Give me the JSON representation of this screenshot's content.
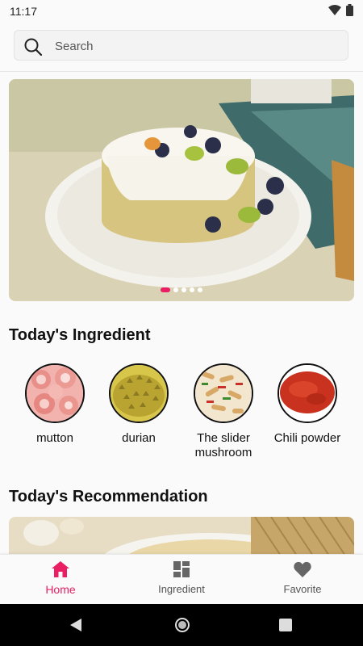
{
  "status": {
    "time": "11:17"
  },
  "search": {
    "placeholder": "Search"
  },
  "banner": {
    "dot_count": 5,
    "active_index": 0
  },
  "sections": {
    "ingredient_title": "Today's Ingredient",
    "recommendation_title": "Today's Recommendation"
  },
  "ingredients": [
    {
      "label": "mutton"
    },
    {
      "label": "durian"
    },
    {
      "label": "The slider mushroom"
    },
    {
      "label": "Chili powder"
    }
  ],
  "nav": {
    "home": "Home",
    "ingredient": "Ingredient",
    "favorite": "Favorite"
  },
  "colors": {
    "accent": "#e91e63"
  }
}
